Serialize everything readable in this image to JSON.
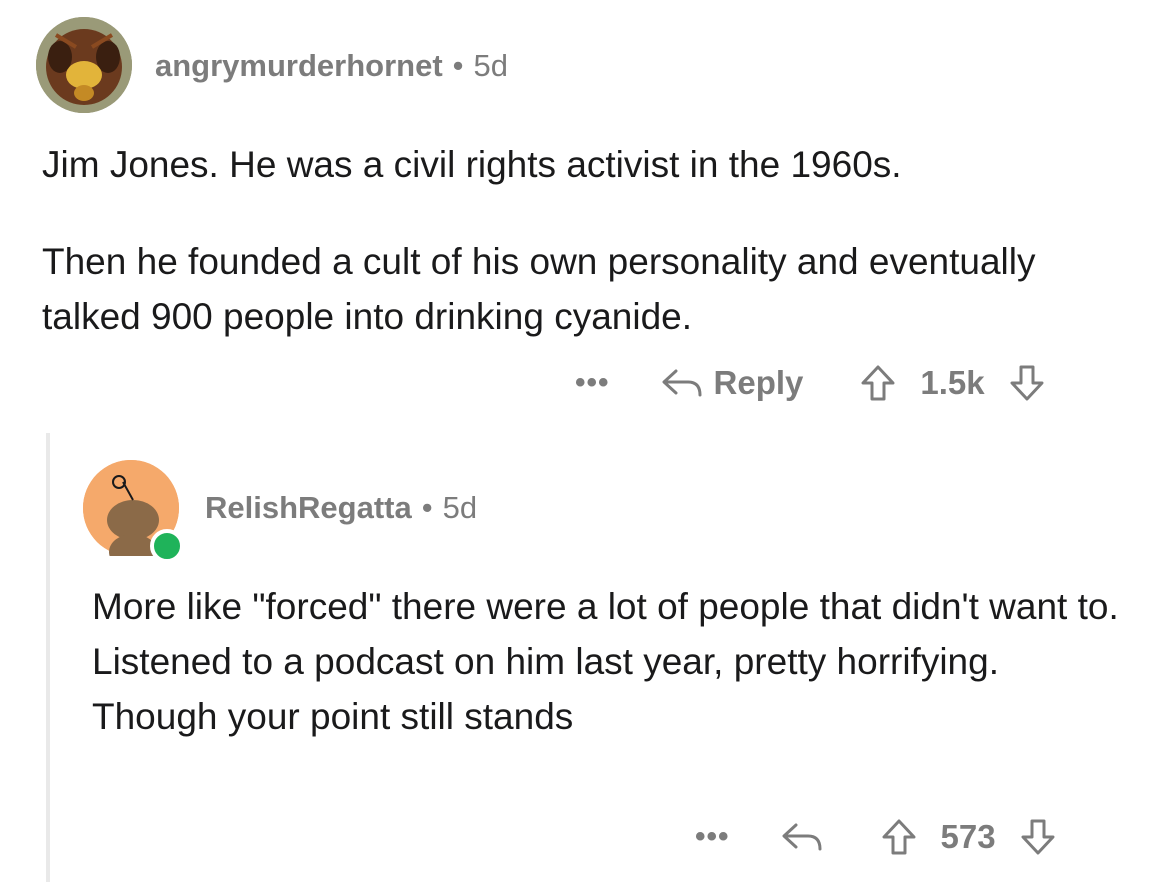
{
  "comments": [
    {
      "username": "angrymurderhornet",
      "separator": "•",
      "age": "5d",
      "paragraphs": [
        "Jim Jones. He was a civil rights activist in the 1960s.",
        "Then he founded a cult of his own personality and eventually talked 900 people into drinking cyanide."
      ],
      "actions": {
        "more": "•••",
        "reply_label": "Reply",
        "vote_count": "1.5k"
      },
      "avatar_icon": "hornet-avatar-icon"
    },
    {
      "username": "RelishRegatta",
      "separator": "•",
      "age": "5d",
      "paragraphs": [
        "More like \"forced\" there were a lot of people that didn't want to. Listened to a podcast on him last year, pretty horrifying. Though your point still stands"
      ],
      "actions": {
        "more": "•••",
        "vote_count": "573"
      },
      "avatar_icon": "snoo-avatar-icon",
      "online": true
    }
  ],
  "colors": {
    "text": "#1a1a1b",
    "meta": "#7c7c7c",
    "online": "#1fb35a",
    "thread_line": "#e9e9e9",
    "avatar2_bg": "#f5a96b"
  }
}
